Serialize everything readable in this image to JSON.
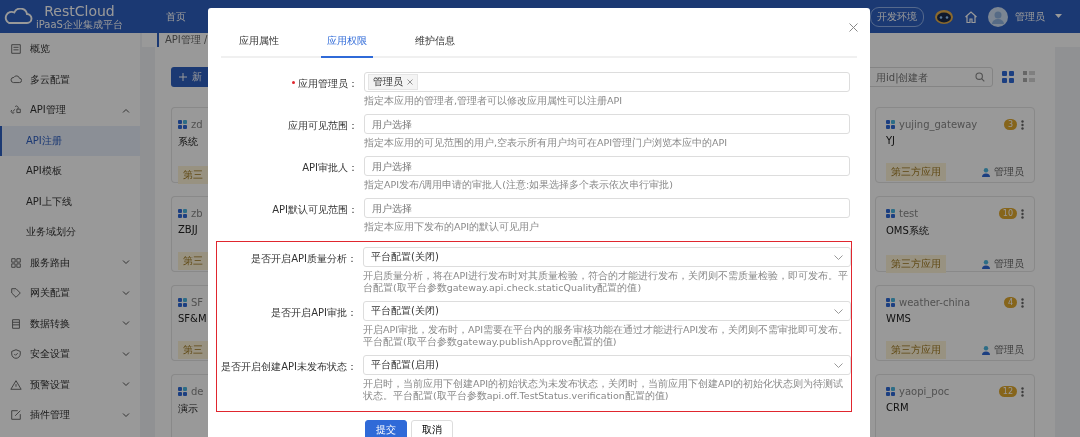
{
  "header": {
    "logo_title": "RestCloud",
    "logo_subtitle": "iPaaS企业集成平台",
    "nav_item": "首页",
    "environment": "开发环境",
    "user": "管理员"
  },
  "sidebar": {
    "items": [
      {
        "kind": "link",
        "label": "概览"
      },
      {
        "kind": "link",
        "label": "多云配置"
      },
      {
        "kind": "group",
        "label": "API管理",
        "expanded": true,
        "children": [
          {
            "label": "API注册",
            "selected": true
          },
          {
            "label": "API模板",
            "selected": false
          },
          {
            "label": "API上下线",
            "selected": false
          },
          {
            "label": "业务域划分",
            "selected": false
          }
        ]
      },
      {
        "kind": "group",
        "label": "服务路由",
        "expanded": false
      },
      {
        "kind": "group",
        "label": "网关配置",
        "expanded": false
      },
      {
        "kind": "group",
        "label": "数据转换",
        "expanded": false
      },
      {
        "kind": "group",
        "label": "安全设置",
        "expanded": false
      },
      {
        "kind": "group",
        "label": "预警设置",
        "expanded": false
      },
      {
        "kind": "group",
        "label": "插件管理",
        "expanded": false
      }
    ]
  },
  "breadcrumb": "API管理 /",
  "new_button": "新",
  "search": {
    "placeholder": "用id|创建者"
  },
  "view_modes": [
    {
      "selected": true
    },
    {
      "selected": false
    }
  ],
  "cards_left": [
    {
      "code": "zd",
      "name": "系统",
      "tag": "第三"
    },
    {
      "code": "zb",
      "name": "ZBJJ",
      "tag": "第三"
    },
    {
      "code": "SF",
      "name": "SF&M",
      "tag": "第三"
    },
    {
      "code": "de",
      "name": "演示"
    }
  ],
  "cards_right": [
    {
      "code": "yujing_gateway",
      "name": "YJ",
      "count": "3",
      "tag": "第三方应用",
      "owner": "管理员"
    },
    {
      "code": "test",
      "name": "OMS系统",
      "count": "10",
      "tag": "第三方应用",
      "owner": "管理员"
    },
    {
      "code": "weather-china",
      "name": "WMS",
      "count": "4",
      "tag": "第三方应用",
      "owner": "管理员"
    },
    {
      "code": "yaopi_poc",
      "name": "CRM",
      "count": "12"
    }
  ],
  "modal": {
    "tabs": [
      {
        "label": "应用属性",
        "selected": false
      },
      {
        "label": "应用权限",
        "selected": true
      },
      {
        "label": "维护信息",
        "selected": false
      }
    ],
    "fields": [
      {
        "kind": "tags",
        "label": "应用管理员：",
        "required": true,
        "highlighted": false,
        "tags": [
          "管理员"
        ],
        "hint": "指定本应用的管理者,管理者可以修改应用属性可以注册API"
      },
      {
        "kind": "picker",
        "label": "应用可见范围：",
        "required": false,
        "highlighted": false,
        "placeholder": "用户选择",
        "hint": "指定本应用的可见范围的用户,空表示所有用户均可在API管理门户浏览本应中的API"
      },
      {
        "kind": "picker",
        "label": "API审批人：",
        "required": false,
        "highlighted": false,
        "placeholder": "用户选择",
        "hint": "指定API发布/调用申请的审批人(注意:如果选择多个表示依次串行审批)"
      },
      {
        "kind": "picker",
        "label": "API默认可见范围：",
        "required": false,
        "highlighted": false,
        "placeholder": "用户选择",
        "hint": "指定本应用下发布的API的默认可见用户"
      },
      {
        "kind": "select",
        "label": "是否开启API质量分析：",
        "required": false,
        "highlighted": true,
        "value": "平台配置(关闭)",
        "hint": "开启质量分析，将在API进行发布时对其质量检验，符合的才能进行发布，关闭则不需质量检验，即可发布。平台配置(取平台参数gateway.api.check.staticQuality配置的值)"
      },
      {
        "kind": "select",
        "label": "是否开启API审批：",
        "required": false,
        "highlighted": true,
        "value": "平台配置(关闭)",
        "hint": "开启API审批，发布时，API需要在平台内的服务审核功能在通过才能进行API发布，关闭则不需审批即可发布。平台配置(取平台参数gateway.publishApprove配置的值)"
      },
      {
        "kind": "select",
        "label": "是否开启创建API未发布状态：",
        "required": false,
        "highlighted": true,
        "value": "平台配置(启用)",
        "hint": "开启时，当前应用下创建API的初始状态为未发布状态，关闭时，当前应用下创建API的初始化状态则为待测试状态。平台配置(取平台参数api.off.TestStatus.verification配置的值)"
      }
    ],
    "buttons": [
      {
        "kind": "primary",
        "label": "提交"
      },
      {
        "kind": "default",
        "label": "取消"
      }
    ]
  }
}
